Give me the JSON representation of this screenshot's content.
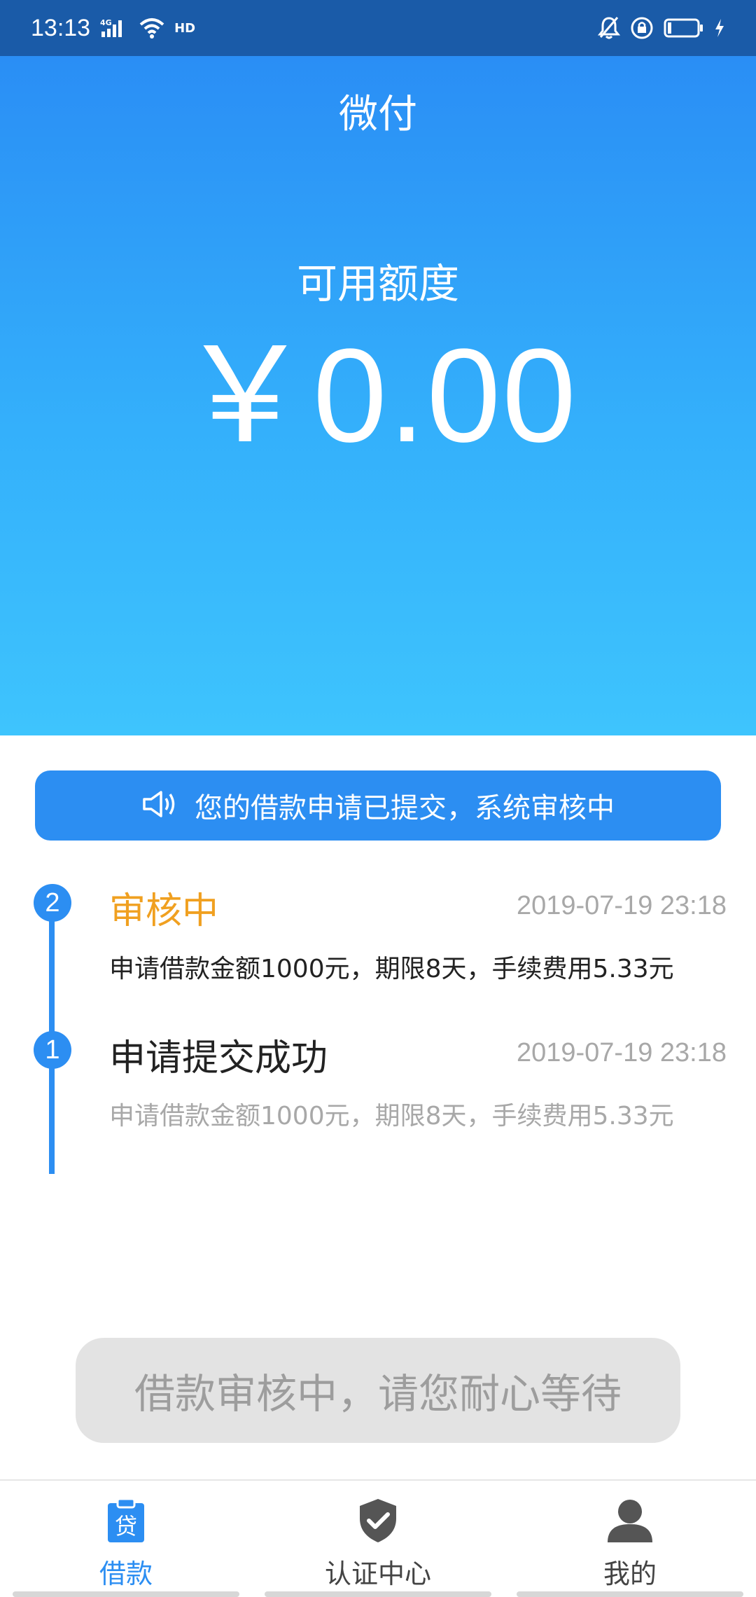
{
  "status_bar": {
    "time": "13:13",
    "signal_label": "4G",
    "hd_label": "HD",
    "icons": [
      "signal-icon",
      "wifi-icon",
      "hd-icon",
      "bell-muted-icon",
      "lock-rotation-icon",
      "battery-icon",
      "charging-icon"
    ]
  },
  "header": {
    "title": "微付"
  },
  "credit": {
    "label": "可用额度",
    "amount": "￥0.00"
  },
  "notice": {
    "text": "您的借款申请已提交，系统审核中",
    "icon": "speaker-icon"
  },
  "timeline": {
    "items": [
      {
        "step": "2",
        "title": "审核中",
        "time": "2019-07-19 23:18",
        "desc": "申请借款金额1000元，期限8天，手续费用5.33元"
      },
      {
        "step": "1",
        "title": "申请提交成功",
        "time": "2019-07-19 23:18",
        "desc": "申请借款金额1000元，期限8天，手续费用5.33元"
      }
    ]
  },
  "action": {
    "label": "借款审核中，请您耐心等待"
  },
  "nav": {
    "items": [
      {
        "label": "借款",
        "icon": "loan-clipboard-icon",
        "badge": "贷",
        "active": true
      },
      {
        "label": "认证中心",
        "icon": "shield-check-icon",
        "active": false
      },
      {
        "label": "我的",
        "icon": "user-icon",
        "active": false
      }
    ]
  },
  "colors": {
    "primary": "#2c8ef2",
    "pending": "#f0a020",
    "status_bar": "#1a5ba8",
    "muted": "#a8a8a8",
    "button_bg": "#e3e3e3"
  }
}
